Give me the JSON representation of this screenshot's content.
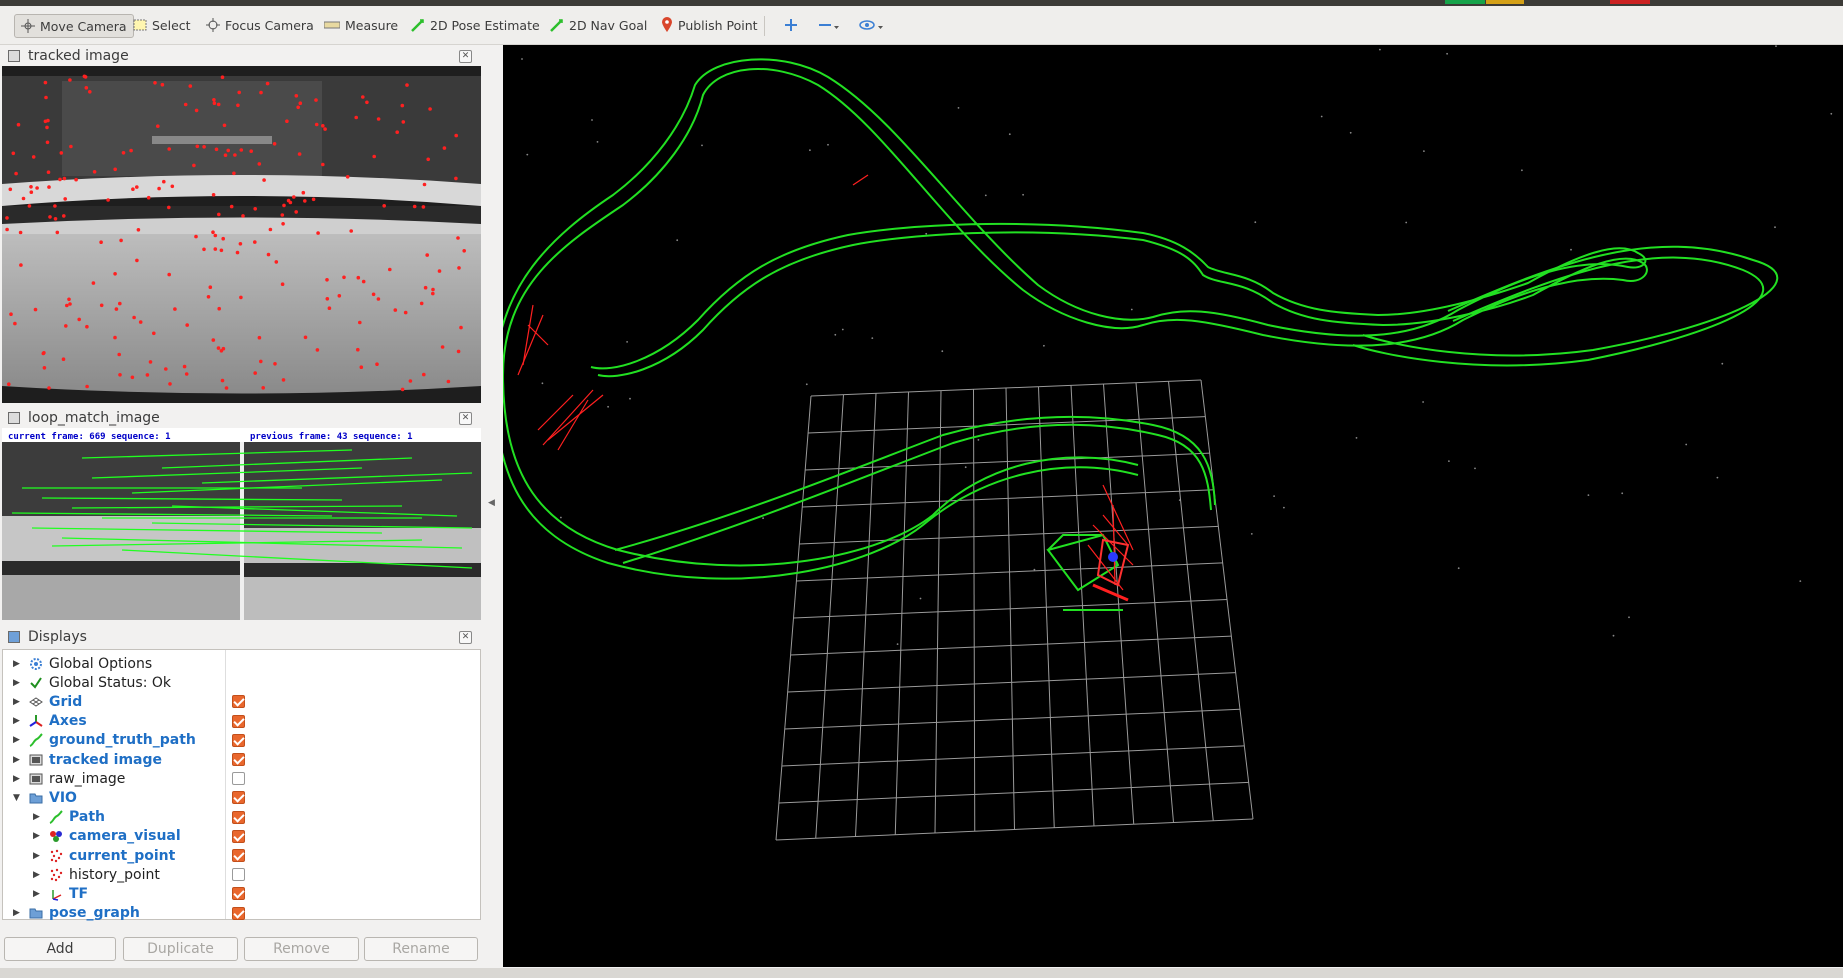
{
  "toolbar": {
    "tools": [
      {
        "label": "Move Camera",
        "icon": "move-camera-icon"
      },
      {
        "label": "Select",
        "icon": "select-icon"
      },
      {
        "label": "Focus Camera",
        "icon": "focus-camera-icon"
      },
      {
        "label": "Measure",
        "icon": "measure-icon"
      },
      {
        "label": "2D Pose Estimate",
        "icon": "pose-estimate-icon"
      },
      {
        "label": "2D Nav Goal",
        "icon": "nav-goal-icon"
      },
      {
        "label": "Publish Point",
        "icon": "publish-point-icon"
      }
    ],
    "extra_icons": [
      "plus-icon",
      "minus-icon",
      "eye-icon"
    ]
  },
  "panels": {
    "tracked": {
      "title": "tracked image"
    },
    "loop": {
      "title": "loop_match_image",
      "left_caption": "current  frame:  669    sequence:  1",
      "right_caption": "previous  frame:  43    sequence:  1"
    },
    "displays": {
      "title": "Displays"
    }
  },
  "displays": {
    "items": [
      {
        "label": "Global Options",
        "icon": "gear-icon",
        "checked": null,
        "blue": false,
        "indent": 0,
        "expanded": false
      },
      {
        "label": "Global Status: Ok",
        "icon": "checkmark-icon",
        "checked": null,
        "blue": false,
        "indent": 0,
        "expanded": false
      },
      {
        "label": "Grid",
        "icon": "grid-icon",
        "checked": true,
        "blue": true,
        "indent": 0,
        "expanded": false
      },
      {
        "label": "Axes",
        "icon": "axes-icon",
        "checked": true,
        "blue": true,
        "indent": 0,
        "expanded": false
      },
      {
        "label": "ground_truth_path",
        "icon": "path-icon",
        "checked": true,
        "blue": true,
        "indent": 0,
        "expanded": false
      },
      {
        "label": "tracked image",
        "icon": "image-icon",
        "checked": true,
        "blue": true,
        "indent": 0,
        "expanded": false
      },
      {
        "label": "raw_image",
        "icon": "image-icon",
        "checked": false,
        "blue": false,
        "indent": 0,
        "expanded": false
      },
      {
        "label": "VIO",
        "icon": "folder-icon",
        "checked": true,
        "blue": true,
        "indent": 0,
        "expanded": true
      },
      {
        "label": "Path",
        "icon": "path-icon",
        "checked": true,
        "blue": true,
        "indent": 1,
        "expanded": false
      },
      {
        "label": "camera_visual",
        "icon": "marker-icon",
        "checked": true,
        "blue": true,
        "indent": 1,
        "expanded": false
      },
      {
        "label": "current_point",
        "icon": "pointcloud-icon",
        "checked": true,
        "blue": true,
        "indent": 1,
        "expanded": false
      },
      {
        "label": "history_point",
        "icon": "pointcloud-icon",
        "checked": false,
        "blue": false,
        "indent": 1,
        "expanded": false
      },
      {
        "label": "TF",
        "icon": "tf-icon",
        "checked": true,
        "blue": true,
        "indent": 1,
        "expanded": false
      },
      {
        "label": "pose_graph",
        "icon": "folder-icon",
        "checked": true,
        "blue": true,
        "indent": 0,
        "expanded": false
      }
    ],
    "buttons": {
      "add": "Add",
      "duplicate": "Duplicate",
      "remove": "Remove",
      "rename": "Rename"
    }
  },
  "colors": {
    "accent_checkbox": "#e9672d",
    "path_green": "#22e022",
    "feature_red": "#ff2020",
    "grid_gray": "#a0a0a0",
    "label_blue": "#1f6fc5",
    "viewport_bg": "#000000"
  }
}
